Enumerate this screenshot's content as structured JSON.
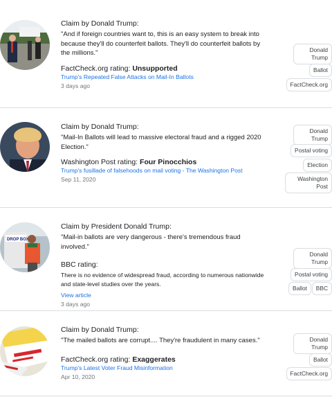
{
  "cards": [
    {
      "claim_by": "Claim by Donald Trump:",
      "claim": "\"And if foreign countries want to, this is an easy system to break into because they'll do counterfeit ballots. They'll do counterfeit ballots by the millions.\"",
      "publisher": "FactCheck.org",
      "rating_label": " rating: ",
      "rating": "Unsupported",
      "link": "Trump's Repeated False Attacks on Mail-In Ballots",
      "date": "3 days ago",
      "tags": [
        "Donald Trump",
        "Ballot",
        "FactCheck.org"
      ]
    },
    {
      "claim_by": "Claim by Donald Trump:",
      "claim": "\"Mail-In Ballots will lead to massive electoral fraud and a rigged 2020 Election.\"",
      "publisher": "Washington Post",
      "rating_label": " rating: ",
      "rating": "Four Pinocchios",
      "link": "Trump's fusillade of falsehoods on mail voting - The Washington Post",
      "date": "Sep 11, 2020",
      "tags": [
        "Donald Trump",
        "Postal voting",
        "Election",
        "Washington Post"
      ]
    },
    {
      "claim_by": "Claim by President Donald Trump:",
      "claim": "\"Mail-in ballots are very dangerous - there's tremendous fraud involved.\"",
      "publisher": "BBC",
      "rating_label": " rating:",
      "rating": "",
      "description": "There is no evidence of widespread fraud, according to numerous nationwide and state-level studies over the years.",
      "link": "View article",
      "date": "3 days ago",
      "tags": [
        "Donald Trump",
        "Postal voting",
        "Ballot",
        "BBC"
      ]
    },
    {
      "claim_by": "Claim by Donald Trump:",
      "claim": "\"The mailed ballots are corrupt.... They're fraudulent in many cases.\"",
      "publisher": "FactCheck.org",
      "rating_label": " rating: ",
      "rating": "Exaggerates",
      "link": "Trump's Latest Voter Fraud Misinformation",
      "date": "Apr 10, 2020",
      "tags": [
        "Donald Trump",
        "Ballot",
        "FactCheck.org"
      ]
    }
  ],
  "images": [
    "trump-outdoor-photo",
    "trump-portrait-photo",
    "mail-drop-box-photo",
    "mailed-ballots-photo"
  ]
}
